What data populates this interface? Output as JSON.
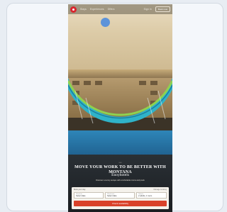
{
  "topbar": {
    "nav_links": [
      "Stays",
      "Experiences",
      "Offers"
    ],
    "sign_in_label": "Sign in",
    "book_label": "Book now"
  },
  "hero": {
    "eyebrow": "• • •",
    "headline": "MOVE YOUR WORK TO BE BETTER WITH MONTANA",
    "subline": "Enoyhotels",
    "caption": "Discover a sunny escape with comfortable rooms and pools"
  },
  "booking": {
    "heading": "Book your stay",
    "link_label": "Manage booking",
    "fields": [
      {
        "label": "Check-in",
        "value": "Select date"
      },
      {
        "label": "Check-out",
        "value": "Select date"
      },
      {
        "label": "Guests",
        "value": "2 adults, 1 room"
      }
    ],
    "cta_label": "Check availability"
  },
  "colors": {
    "brand_red": "#d8262e",
    "cta_orange": "#d9412a",
    "accent_blue": "#5d93d9"
  }
}
